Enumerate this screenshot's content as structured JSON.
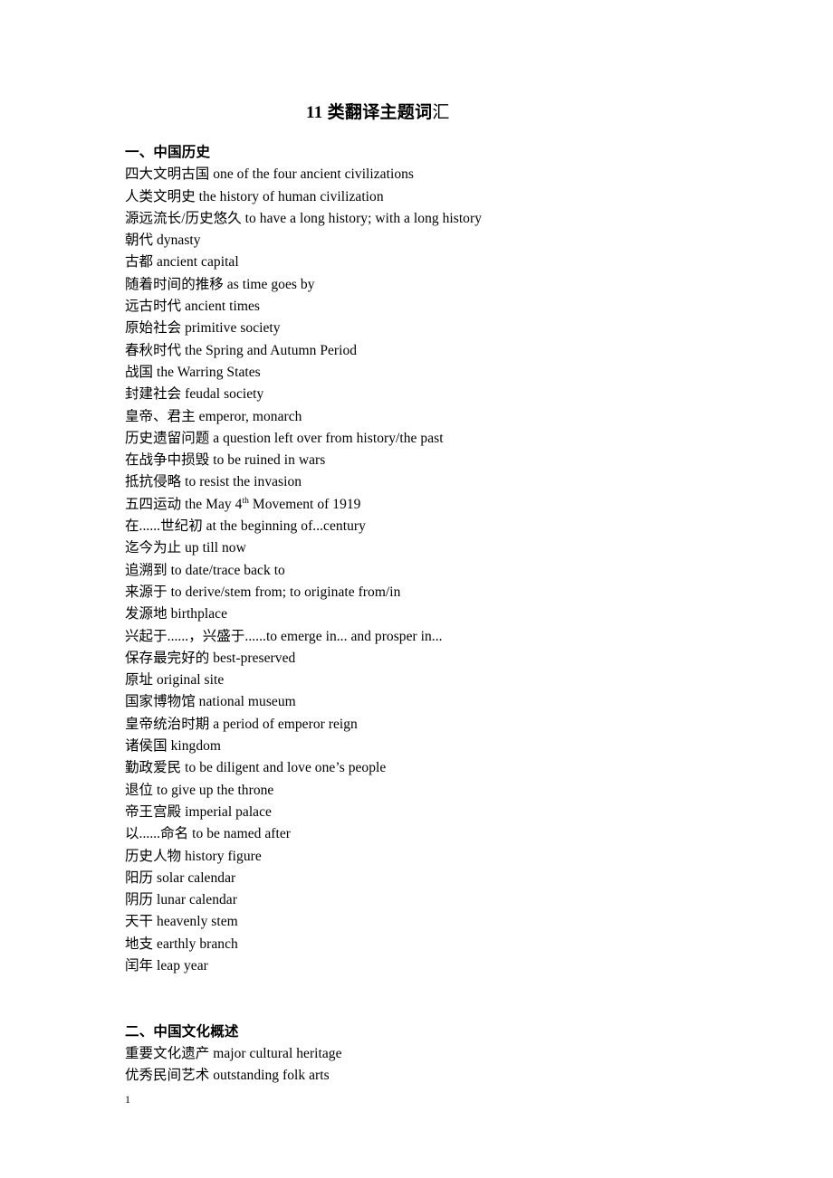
{
  "document": {
    "title_main": "11 类翻译主题词",
    "title_tail": "汇",
    "page_number": "1",
    "sections": [
      {
        "heading": "一、中国历史",
        "entries": [
          {
            "text": "四大文明古国 one of the four ancient civilizations"
          },
          {
            "text": "人类文明史 the history of human civilization"
          },
          {
            "text": "源远流长/历史悠久 to have a long history; with a long history"
          },
          {
            "text": "朝代 dynasty"
          },
          {
            "text": "古都  ancient capital"
          },
          {
            "text": "随着时间的推移  as time goes by"
          },
          {
            "text": "远古时代 ancient times"
          },
          {
            "text": "原始社会 primitive society"
          },
          {
            "text": "春秋时代  the Spring and Autumn Period"
          },
          {
            "text": "战国  the Warring States"
          },
          {
            "text": "封建社会  feudal society"
          },
          {
            "text": "皇帝、君主 emperor, monarch"
          },
          {
            "text": "历史遗留问题 a question left over from history/the past"
          },
          {
            "text": "在战争中损毁  to be ruined in wars"
          },
          {
            "text": "抵抗侵略  to resist the invasion"
          },
          {
            "pre": "五四运动  the May 4",
            "sup": "th",
            "post": " Movement of 1919"
          },
          {
            "text": "在......世纪初 at the beginning of...century"
          },
          {
            "text": "迄今为止 up till now"
          },
          {
            "text": "追溯到  to date/trace back to"
          },
          {
            "text": "来源于  to derive/stem from; to originate from/in"
          },
          {
            "text": "发源地  birthplace"
          },
          {
            "text": "兴起于......，兴盛于......to emerge in... and prosper in..."
          },
          {
            "text": "保存最完好的 best-preserved"
          },
          {
            "text": "原址 original site"
          },
          {
            "text": "国家博物馆 national museum"
          },
          {
            "text": "皇帝统治时期 a period of emperor reign"
          },
          {
            "text": "诸侯国 kingdom"
          },
          {
            "text": "勤政爱民 to be diligent and love one’s people"
          },
          {
            "text": "退位  to give up the throne"
          },
          {
            "text": "帝王宫殿 imperial palace"
          },
          {
            "text": "以......命名 to be named after"
          },
          {
            "text": "历史人物 history figure"
          },
          {
            "text": "阳历  solar calendar"
          },
          {
            "text": "阴历  lunar calendar"
          },
          {
            "text": "天干  heavenly stem"
          },
          {
            "text": "地支 earthly branch"
          },
          {
            "text": "闰年  leap year"
          }
        ]
      },
      {
        "heading": "二、中国文化概述",
        "entries": [
          {
            "text": "重要文化遗产  major cultural heritage"
          },
          {
            "text": "优秀民间艺术  outstanding folk arts"
          }
        ]
      }
    ]
  }
}
